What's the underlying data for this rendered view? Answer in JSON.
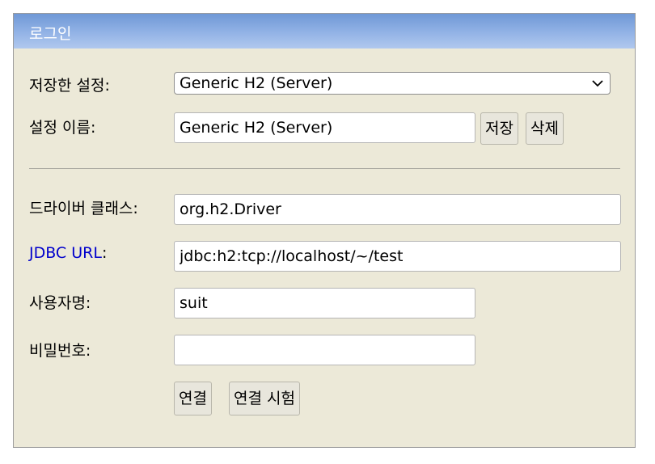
{
  "panel": {
    "title": "로그인"
  },
  "form": {
    "saved_settings_label": "저장한 설정:",
    "saved_settings_value": "Generic H2 (Server)",
    "setting_name_label": "설정 이름:",
    "setting_name_value": "Generic H2 (Server)",
    "save_button": "저장",
    "delete_button": "삭제",
    "driver_class_label": "드라이버 클래스:",
    "driver_class_value": "org.h2.Driver",
    "jdbc_url_link": "JDBC URL",
    "jdbc_url_colon": ":",
    "jdbc_url_value": "jdbc:h2:tcp://localhost/~/test",
    "username_label": "사용자명:",
    "username_value": "suit",
    "password_label": "비밀번호:",
    "password_value": "",
    "connect_button": "연결",
    "test_connection_button": "연결 시험"
  },
  "colors": {
    "panel_background": "#ece9d8",
    "header_gradient_top": "#6f98d6",
    "header_gradient_bottom": "#b0c8ee",
    "link": "#0000cc"
  },
  "icons": {
    "select_arrow": "chevron-down-icon"
  }
}
